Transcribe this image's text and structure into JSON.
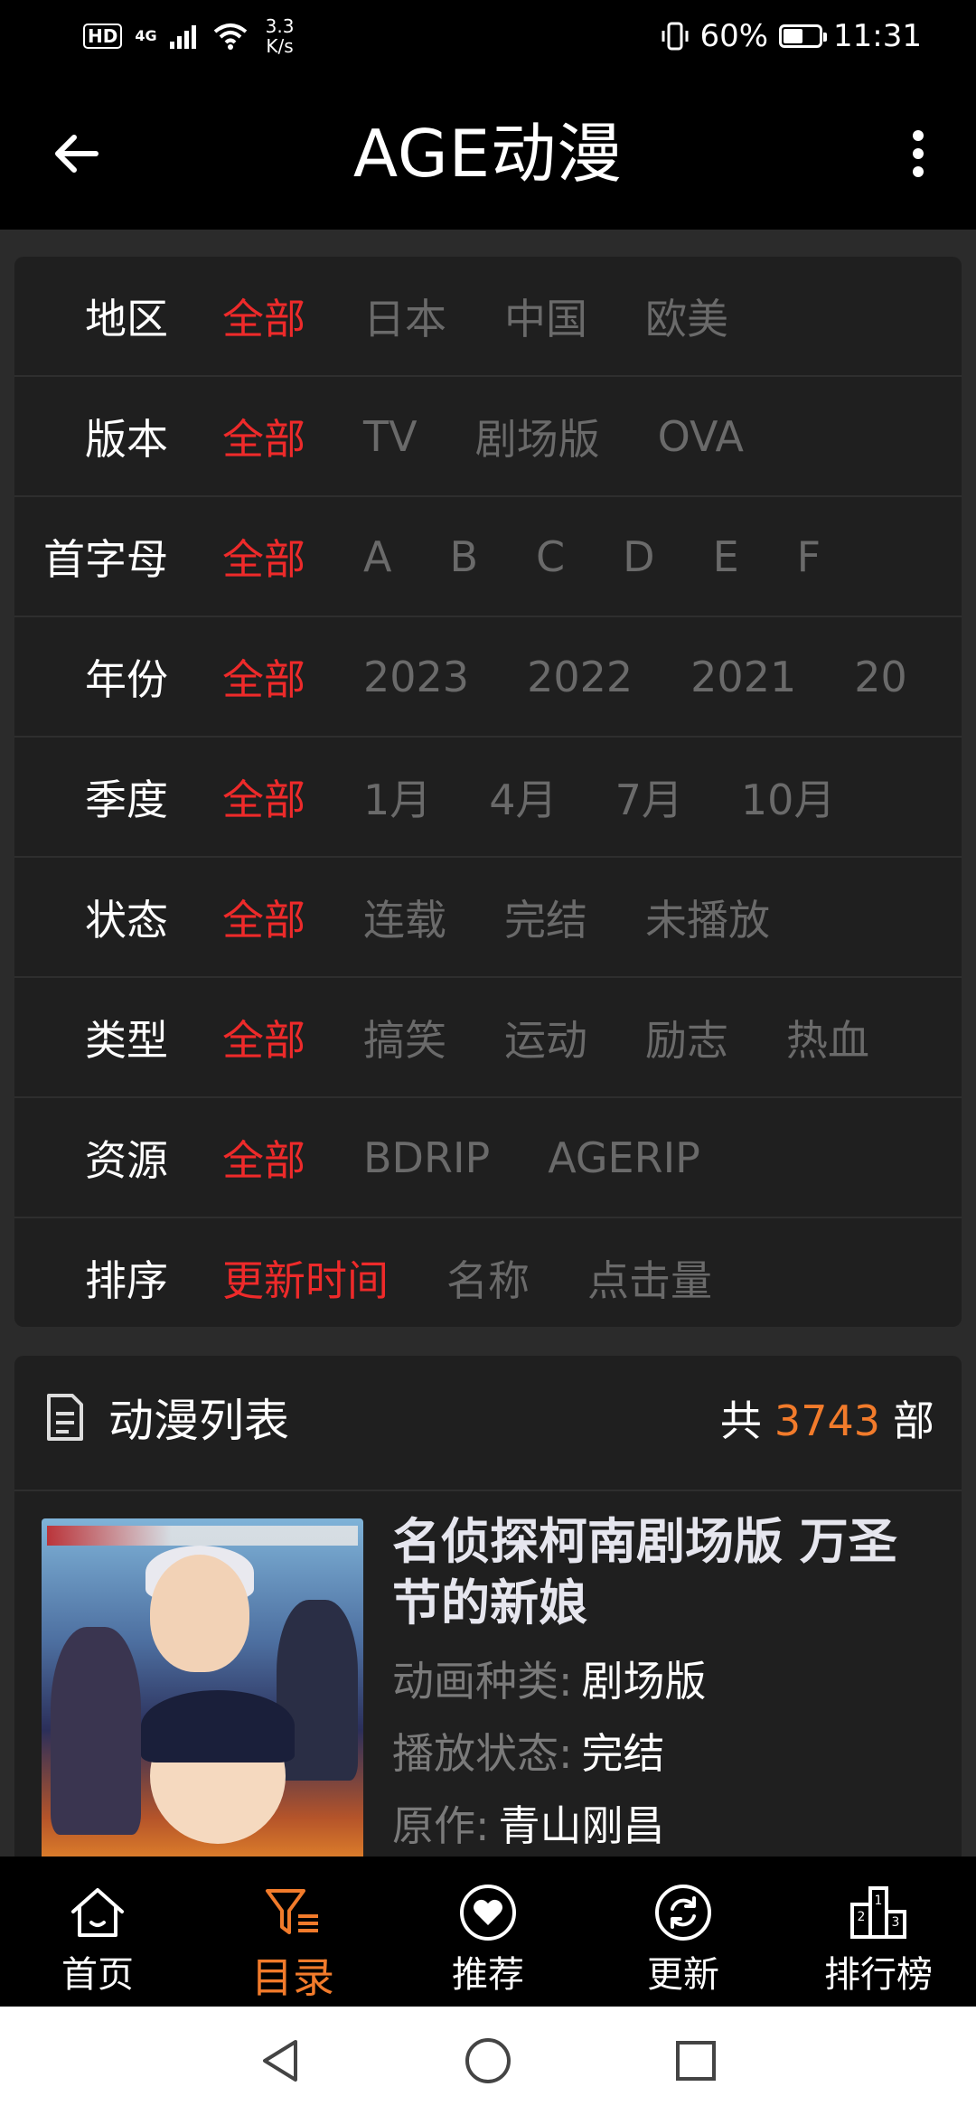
{
  "status_bar": {
    "hd": "HD",
    "signal": "4G",
    "net_speed": "3.3\nK/s",
    "battery_percent": "60%",
    "battery_level": 0.6,
    "time": "11:31"
  },
  "app_bar": {
    "title": "AGE动漫"
  },
  "filters": [
    {
      "label": "地区",
      "options": [
        "全部",
        "日本",
        "中国",
        "欧美"
      ],
      "selected": "全部"
    },
    {
      "label": "版本",
      "options": [
        "全部",
        "TV",
        "剧场版",
        "OVA"
      ],
      "selected": "全部"
    },
    {
      "label": "首字母",
      "options": [
        "全部",
        "A",
        "B",
        "C",
        "D",
        "E",
        "F"
      ],
      "selected": "全部"
    },
    {
      "label": "年份",
      "options": [
        "全部",
        "2023",
        "2022",
        "2021",
        "20"
      ],
      "selected": "全部"
    },
    {
      "label": "季度",
      "options": [
        "全部",
        "1月",
        "4月",
        "7月",
        "10月"
      ],
      "selected": "全部"
    },
    {
      "label": "状态",
      "options": [
        "全部",
        "连载",
        "完结",
        "未播放"
      ],
      "selected": "全部"
    },
    {
      "label": "类型",
      "options": [
        "全部",
        "搞笑",
        "运动",
        "励志",
        "热血"
      ],
      "selected": "全部"
    },
    {
      "label": "资源",
      "options": [
        "全部",
        "BDRIP",
        "AGERIP"
      ],
      "selected": "全部"
    },
    {
      "label": "排序",
      "options": [
        "更新时间",
        "名称",
        "点击量"
      ],
      "selected": "更新时间"
    }
  ],
  "list": {
    "title": "动漫列表",
    "count_prefix": "共",
    "count": "3743",
    "count_suffix": "部",
    "items": [
      {
        "title": "名侦探柯南剧场版 万圣节的新娘",
        "meta": [
          {
            "key": "动画种类:",
            "value": "剧场版"
          },
          {
            "key": "播放状态:",
            "value": "完结"
          },
          {
            "key": "原作:",
            "value": "青山刚昌"
          }
        ]
      }
    ]
  },
  "bottom_nav": [
    {
      "label": "首页",
      "icon": "home-icon"
    },
    {
      "label": "目录",
      "icon": "filter-icon",
      "active": true
    },
    {
      "label": "推荐",
      "icon": "heart-icon"
    },
    {
      "label": "更新",
      "icon": "refresh-icon"
    },
    {
      "label": "排行榜",
      "icon": "ranking-icon"
    }
  ],
  "colors": {
    "accent_red": "#ee2a2a",
    "accent_orange": "#f27b2b",
    "inactive_option": "#6a6a6a"
  }
}
